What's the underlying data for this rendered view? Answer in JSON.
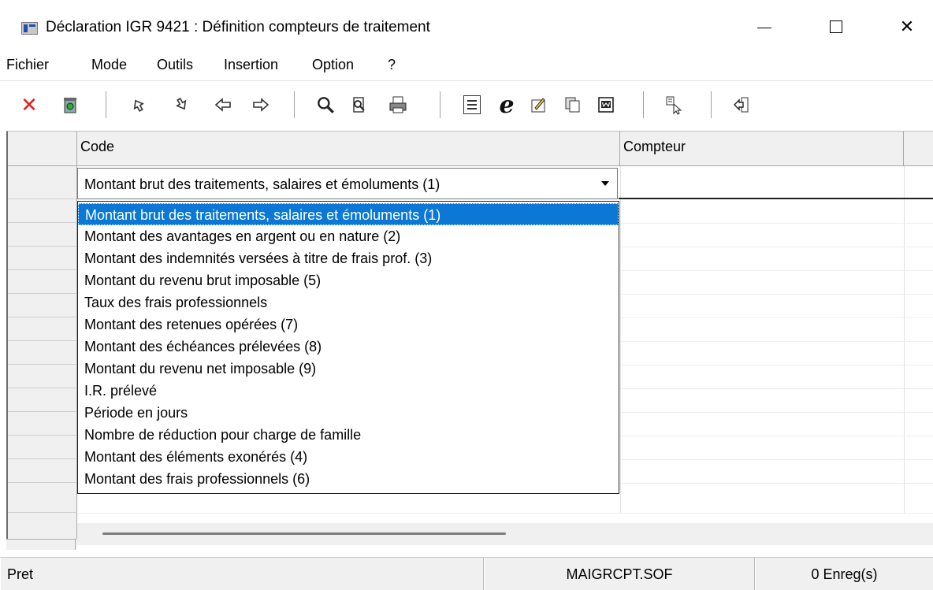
{
  "window": {
    "title": "Déclaration IGR 9421 : Définition compteurs de traitement",
    "close_glyph": "✕"
  },
  "menu": [
    "Fichier",
    "Mode",
    "Outils",
    "Insertion",
    "Option",
    "?"
  ],
  "toolbar": {
    "icons": [
      "delete-icon",
      "recycle-icon",
      "first-record-icon",
      "last-record-icon",
      "previous-icon",
      "next-icon",
      "search-icon",
      "find-icon",
      "print-icon",
      "export-text-icon",
      "internet-explorer-icon",
      "edit-icon",
      "copy-icon",
      "word-export-icon",
      "select-icon",
      "exit-icon"
    ],
    "delete_glyph": "✕",
    "ie_glyph": "e"
  },
  "grid": {
    "columns": [
      "Code",
      "Compteur"
    ],
    "current_code": "Montant brut des traitements, salaires et émoluments (1)",
    "current_compteur": ""
  },
  "dropdown": {
    "options": [
      "Montant brut des traitements, salaires et émoluments (1)",
      "Montant des avantages en argent ou en nature (2)",
      "Montant des indemnités versées à titre de frais prof. (3)",
      "Montant du revenu brut imposable (5)",
      "Taux des frais professionnels",
      "Montant des retenues opérées (7)",
      "Montant des échéances prélevées (8)",
      "Montant du revenu net imposable (9)",
      "I.R. prélevé",
      "Période en jours",
      "Nombre de réduction pour charge de famille",
      "Montant des éléments exonérés (4)",
      "Montant des frais professionnels (6)"
    ],
    "selected_index": 0
  },
  "status": {
    "state": "Pret",
    "file": "MAIGRCPT.SOF",
    "records": "0 Enreg(s)"
  },
  "colors": {
    "selection": "#0a78d4",
    "delete_red": "#e02020"
  }
}
